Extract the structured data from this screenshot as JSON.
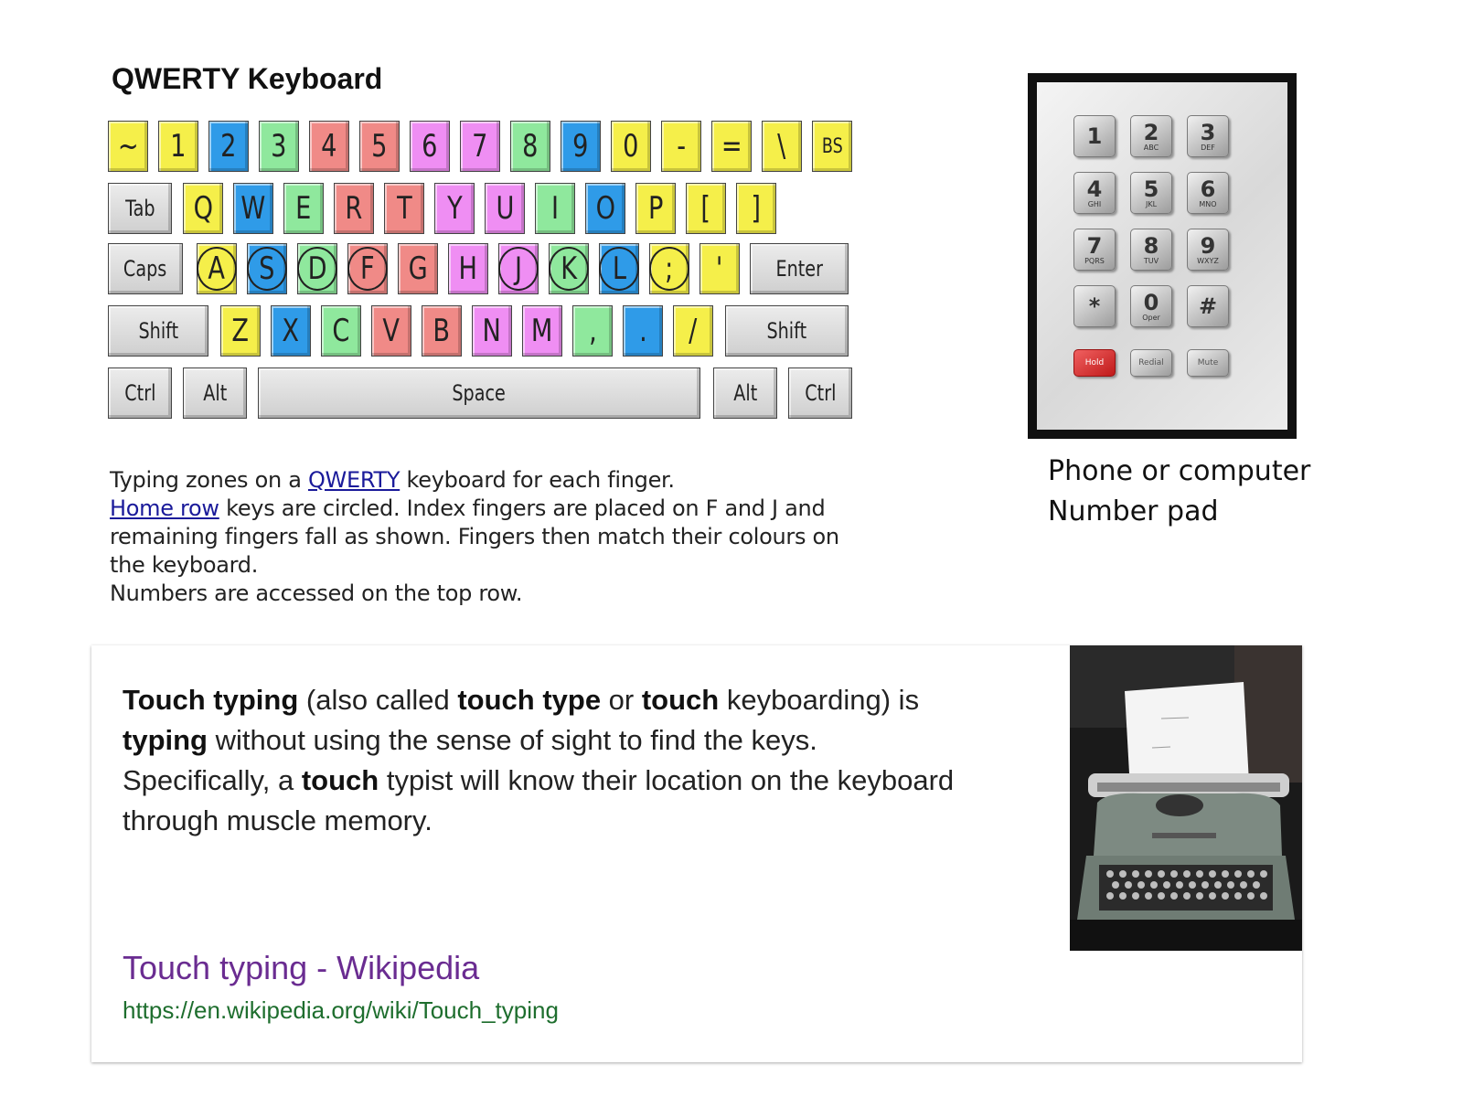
{
  "keyboard": {
    "title": "QWERTY Keyboard",
    "row_number": [
      "~",
      "1",
      "2",
      "3",
      "4",
      "5",
      "6",
      "7",
      "8",
      "9",
      "0",
      "-",
      "=",
      "\\",
      "BS"
    ],
    "row_top": [
      "Tab",
      "Q",
      "W",
      "E",
      "R",
      "T",
      "Y",
      "U",
      "I",
      "O",
      "P",
      "[",
      "]"
    ],
    "row_home": [
      "Caps",
      "A",
      "S",
      "D",
      "F",
      "G",
      "H",
      "J",
      "K",
      "L",
      ";",
      "'",
      "Enter"
    ],
    "row_bottom": [
      "Shift",
      "Z",
      "X",
      "C",
      "V",
      "B",
      "N",
      "M",
      ",",
      ".",
      "/",
      "Shift"
    ],
    "row_space": [
      "Ctrl",
      "Alt",
      "Space",
      "Alt",
      "Ctrl"
    ],
    "colors": {
      "yellow": "#f5ef4a",
      "blue": "#2f9be8",
      "green": "#8fe89d",
      "red": "#f08a87",
      "magenta": "#ef8ef3",
      "gray": "#d8d8d8"
    }
  },
  "caption": {
    "line1_pre": "Typing zones on a ",
    "line1_link": "QWERTY",
    "line1_post": " keyboard for each finger.",
    "line2_link": "Home row",
    "line2_post": " keys are circled. Index fingers are placed on F and J and",
    "line3": "remaining fingers fall as shown. Fingers then match their colours on",
    "line4": "the keyboard.",
    "line5": "Numbers are accessed on the top row."
  },
  "numpad": {
    "keys": [
      {
        "d": "1",
        "s": ""
      },
      {
        "d": "2",
        "s": "ABC"
      },
      {
        "d": "3",
        "s": "DEF"
      },
      {
        "d": "4",
        "s": "GHI"
      },
      {
        "d": "5",
        "s": "JKL"
      },
      {
        "d": "6",
        "s": "MNO"
      },
      {
        "d": "7",
        "s": "PQRS"
      },
      {
        "d": "8",
        "s": "TUV"
      },
      {
        "d": "9",
        "s": "WXYZ"
      },
      {
        "d": "*",
        "s": ""
      },
      {
        "d": "0",
        "s": "Oper"
      },
      {
        "d": "#",
        "s": ""
      }
    ],
    "function_keys": [
      "Hold",
      "Redial",
      "Mute"
    ],
    "caption_line1": "Phone or computer",
    "caption_line2": "Number pad"
  },
  "card": {
    "p1_b1": "Touch typing",
    "p1_t1": " (also called ",
    "p1_b2": "touch type",
    "p1_t2": " or ",
    "p1_b3": "touch",
    "p1_t3": " keyboarding) is",
    "p2_b1": "typing",
    "p2_t1": " without using the sense of sight to find the keys.",
    "p3_t1": "Specifically, a ",
    "p3_b1": "touch",
    "p3_t2": " typist will know their location on the keyboard",
    "p4_t1": "through muscle memory.",
    "link_title": "Touch typing - Wikipedia",
    "link_url": "https://en.wikipedia.org/wiki/Touch_typing"
  }
}
